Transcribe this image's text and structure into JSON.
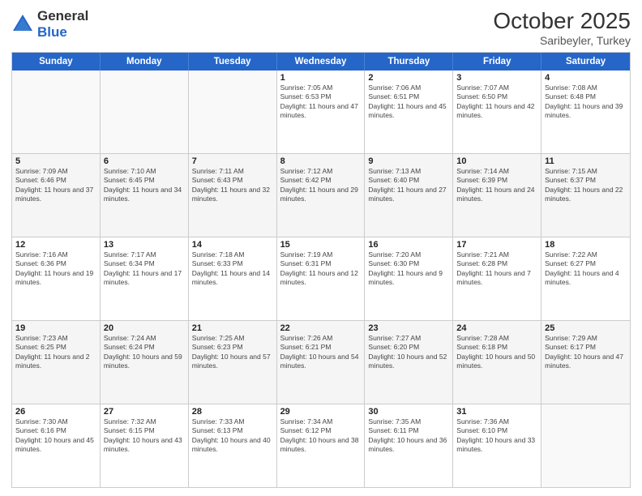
{
  "logo": {
    "general": "General",
    "blue": "Blue"
  },
  "title": {
    "month_year": "October 2025",
    "location": "Saribeyler, Turkey"
  },
  "weekdays": [
    "Sunday",
    "Monday",
    "Tuesday",
    "Wednesday",
    "Thursday",
    "Friday",
    "Saturday"
  ],
  "rows": [
    {
      "cells": [
        {
          "day": "",
          "info": ""
        },
        {
          "day": "",
          "info": ""
        },
        {
          "day": "",
          "info": ""
        },
        {
          "day": "1",
          "info": "Sunrise: 7:05 AM\nSunset: 6:53 PM\nDaylight: 11 hours and 47 minutes."
        },
        {
          "day": "2",
          "info": "Sunrise: 7:06 AM\nSunset: 6:51 PM\nDaylight: 11 hours and 45 minutes."
        },
        {
          "day": "3",
          "info": "Sunrise: 7:07 AM\nSunset: 6:50 PM\nDaylight: 11 hours and 42 minutes."
        },
        {
          "day": "4",
          "info": "Sunrise: 7:08 AM\nSunset: 6:48 PM\nDaylight: 11 hours and 39 minutes."
        }
      ]
    },
    {
      "cells": [
        {
          "day": "5",
          "info": "Sunrise: 7:09 AM\nSunset: 6:46 PM\nDaylight: 11 hours and 37 minutes."
        },
        {
          "day": "6",
          "info": "Sunrise: 7:10 AM\nSunset: 6:45 PM\nDaylight: 11 hours and 34 minutes."
        },
        {
          "day": "7",
          "info": "Sunrise: 7:11 AM\nSunset: 6:43 PM\nDaylight: 11 hours and 32 minutes."
        },
        {
          "day": "8",
          "info": "Sunrise: 7:12 AM\nSunset: 6:42 PM\nDaylight: 11 hours and 29 minutes."
        },
        {
          "day": "9",
          "info": "Sunrise: 7:13 AM\nSunset: 6:40 PM\nDaylight: 11 hours and 27 minutes."
        },
        {
          "day": "10",
          "info": "Sunrise: 7:14 AM\nSunset: 6:39 PM\nDaylight: 11 hours and 24 minutes."
        },
        {
          "day": "11",
          "info": "Sunrise: 7:15 AM\nSunset: 6:37 PM\nDaylight: 11 hours and 22 minutes."
        }
      ]
    },
    {
      "cells": [
        {
          "day": "12",
          "info": "Sunrise: 7:16 AM\nSunset: 6:36 PM\nDaylight: 11 hours and 19 minutes."
        },
        {
          "day": "13",
          "info": "Sunrise: 7:17 AM\nSunset: 6:34 PM\nDaylight: 11 hours and 17 minutes."
        },
        {
          "day": "14",
          "info": "Sunrise: 7:18 AM\nSunset: 6:33 PM\nDaylight: 11 hours and 14 minutes."
        },
        {
          "day": "15",
          "info": "Sunrise: 7:19 AM\nSunset: 6:31 PM\nDaylight: 11 hours and 12 minutes."
        },
        {
          "day": "16",
          "info": "Sunrise: 7:20 AM\nSunset: 6:30 PM\nDaylight: 11 hours and 9 minutes."
        },
        {
          "day": "17",
          "info": "Sunrise: 7:21 AM\nSunset: 6:28 PM\nDaylight: 11 hours and 7 minutes."
        },
        {
          "day": "18",
          "info": "Sunrise: 7:22 AM\nSunset: 6:27 PM\nDaylight: 11 hours and 4 minutes."
        }
      ]
    },
    {
      "cells": [
        {
          "day": "19",
          "info": "Sunrise: 7:23 AM\nSunset: 6:25 PM\nDaylight: 11 hours and 2 minutes."
        },
        {
          "day": "20",
          "info": "Sunrise: 7:24 AM\nSunset: 6:24 PM\nDaylight: 10 hours and 59 minutes."
        },
        {
          "day": "21",
          "info": "Sunrise: 7:25 AM\nSunset: 6:23 PM\nDaylight: 10 hours and 57 minutes."
        },
        {
          "day": "22",
          "info": "Sunrise: 7:26 AM\nSunset: 6:21 PM\nDaylight: 10 hours and 54 minutes."
        },
        {
          "day": "23",
          "info": "Sunrise: 7:27 AM\nSunset: 6:20 PM\nDaylight: 10 hours and 52 minutes."
        },
        {
          "day": "24",
          "info": "Sunrise: 7:28 AM\nSunset: 6:18 PM\nDaylight: 10 hours and 50 minutes."
        },
        {
          "day": "25",
          "info": "Sunrise: 7:29 AM\nSunset: 6:17 PM\nDaylight: 10 hours and 47 minutes."
        }
      ]
    },
    {
      "cells": [
        {
          "day": "26",
          "info": "Sunrise: 7:30 AM\nSunset: 6:16 PM\nDaylight: 10 hours and 45 minutes."
        },
        {
          "day": "27",
          "info": "Sunrise: 7:32 AM\nSunset: 6:15 PM\nDaylight: 10 hours and 43 minutes."
        },
        {
          "day": "28",
          "info": "Sunrise: 7:33 AM\nSunset: 6:13 PM\nDaylight: 10 hours and 40 minutes."
        },
        {
          "day": "29",
          "info": "Sunrise: 7:34 AM\nSunset: 6:12 PM\nDaylight: 10 hours and 38 minutes."
        },
        {
          "day": "30",
          "info": "Sunrise: 7:35 AM\nSunset: 6:11 PM\nDaylight: 10 hours and 36 minutes."
        },
        {
          "day": "31",
          "info": "Sunrise: 7:36 AM\nSunset: 6:10 PM\nDaylight: 10 hours and 33 minutes."
        },
        {
          "day": "",
          "info": ""
        }
      ]
    }
  ]
}
